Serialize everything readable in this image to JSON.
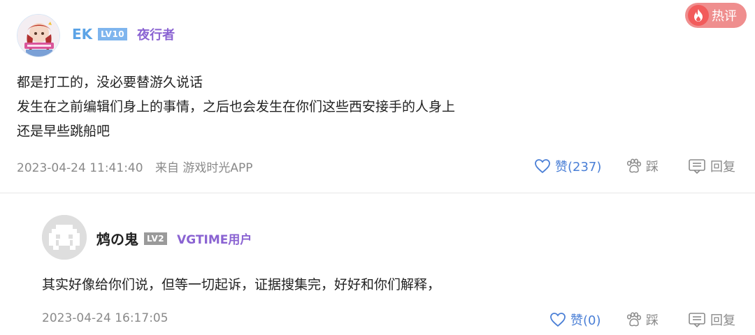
{
  "hot_badge": {
    "label": "热评",
    "color": "#f25b5b"
  },
  "comment": {
    "username": "EK",
    "level": "LV10",
    "tag": "夜行者",
    "lines": [
      "都是打工的，没必要替游久说话",
      "发生在之前编辑们身上的事情，之后也会发生在你们这些西安接手的人身上",
      "还是早些跳船吧"
    ],
    "timestamp": "2023-04-24 11:41:40",
    "source": "来自 游戏时光APP",
    "like_label": "赞(237)",
    "dislike_label": "踩",
    "reply_label": "回复",
    "username_color": "#5ba3e6",
    "tag_color": "#8a63d2"
  },
  "reply": {
    "username": "鸩の鬼",
    "level": "LV2",
    "tag": "VGTIME用户",
    "text": "其实好像给你们说，但等一切起诉，证据搜集完，好好和你们解释，",
    "timestamp": "2023-04-24 16:17:05",
    "like_label": "赞(0)",
    "dislike_label": "踩",
    "reply_label": "回复",
    "tag_color": "#8a63d2"
  }
}
